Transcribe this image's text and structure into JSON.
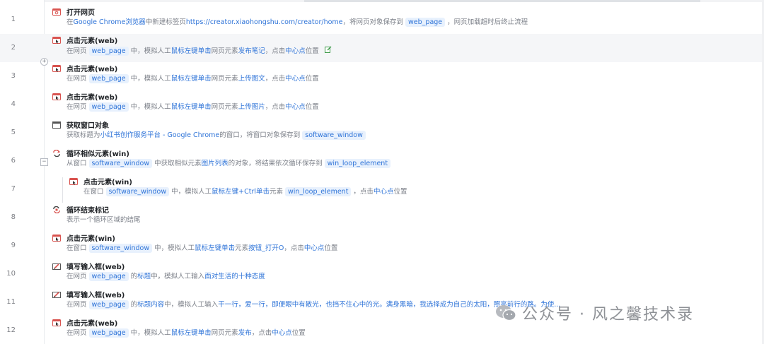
{
  "colors": {
    "accent": "#2f74d8",
    "tag_bg": "#e8f1fd",
    "title": "#202327",
    "muted": "#7c8089",
    "icon_red": "#d9534f"
  },
  "steps": [
    {
      "line": "1",
      "icon": "browser-open-icon",
      "title": "打开网页",
      "desc": [
        {
          "t": "在"
        },
        {
          "t": "Google Chrome浏览器",
          "s": "hl"
        },
        {
          "t": "中新建标签页"
        },
        {
          "t": "https://creator.xiaohongshu.com/creator/home",
          "s": "hl"
        },
        {
          "t": "，将网页对象保存到"
        },
        {
          "t": "web_page",
          "s": "tag"
        },
        {
          "t": "，网页加载超时后终止流程"
        }
      ]
    },
    {
      "line": "2",
      "icon": "click-element-icon",
      "title": "点击元素(web)",
      "desc": [
        {
          "t": "在网页"
        },
        {
          "t": "web_page",
          "s": "tag"
        },
        {
          "t": "中，模拟人工"
        },
        {
          "t": "鼠标左键单击",
          "s": "hl"
        },
        {
          "t": "网页元素"
        },
        {
          "t": "发布笔记",
          "s": "hl"
        },
        {
          "t": "，点击"
        },
        {
          "t": "中心点",
          "s": "hl"
        },
        {
          "t": "位置"
        }
      ]
    },
    {
      "line": "3",
      "icon": "click-element-icon",
      "title": "点击元素(web)",
      "desc": [
        {
          "t": "在网页"
        },
        {
          "t": "web_page",
          "s": "tag"
        },
        {
          "t": "中，模拟人工"
        },
        {
          "t": "鼠标左键单击",
          "s": "hl"
        },
        {
          "t": "网页元素"
        },
        {
          "t": "上传图文",
          "s": "hl"
        },
        {
          "t": "，点击"
        },
        {
          "t": "中心点",
          "s": "hl"
        },
        {
          "t": "位置"
        }
      ]
    },
    {
      "line": "4",
      "icon": "click-element-icon",
      "title": "点击元素(web)",
      "desc": [
        {
          "t": "在网页"
        },
        {
          "t": "web_page",
          "s": "tag"
        },
        {
          "t": "中，模拟人工"
        },
        {
          "t": "鼠标左键单击",
          "s": "hl"
        },
        {
          "t": "网页元素"
        },
        {
          "t": "上传图片",
          "s": "hl"
        },
        {
          "t": "，点击"
        },
        {
          "t": "中心点",
          "s": "hl"
        },
        {
          "t": "位置"
        }
      ]
    },
    {
      "line": "5",
      "icon": "window-icon",
      "title": "获取窗口对象",
      "desc": [
        {
          "t": "获取标题为"
        },
        {
          "t": "小红书创作服务平台 - Google Chrome",
          "s": "hl"
        },
        {
          "t": "的窗口，将窗口对象保存到"
        },
        {
          "t": "software_window",
          "s": "tag"
        }
      ]
    },
    {
      "line": "6",
      "icon": "loop-icon",
      "title": "循环相似元素(win)",
      "desc": [
        {
          "t": "从窗口"
        },
        {
          "t": "software_window",
          "s": "tag"
        },
        {
          "t": "中获取相似元素"
        },
        {
          "t": "图片列表",
          "s": "hl"
        },
        {
          "t": "的对象，将结果依次循环保存到"
        },
        {
          "t": "win_loop_element",
          "s": "tag"
        }
      ]
    },
    {
      "line": "7",
      "icon": "click-element-icon",
      "title": "点击元素(win)",
      "desc": [
        {
          "t": "在窗口"
        },
        {
          "t": "software_window",
          "s": "tag"
        },
        {
          "t": "中，模拟人工"
        },
        {
          "t": "鼠标左键+Ctrl单击",
          "s": "hl"
        },
        {
          "t": "元素"
        },
        {
          "t": "win_loop_element",
          "s": "tag"
        },
        {
          "t": "，点击"
        },
        {
          "t": "中心点",
          "s": "hl"
        },
        {
          "t": "位置"
        }
      ]
    },
    {
      "line": "8",
      "icon": "loop-end-icon",
      "title": "循环结束标记",
      "desc": [
        {
          "t": "表示一个循环区域的结尾"
        }
      ]
    },
    {
      "line": "9",
      "icon": "click-element-icon",
      "title": "点击元素(win)",
      "desc": [
        {
          "t": "在窗口"
        },
        {
          "t": "software_window",
          "s": "tag"
        },
        {
          "t": "中，模拟人工"
        },
        {
          "t": "鼠标左键单击",
          "s": "hl"
        },
        {
          "t": "元素"
        },
        {
          "t": "按钮_打开O",
          "s": "hl"
        },
        {
          "t": "，点击"
        },
        {
          "t": "中心点",
          "s": "hl"
        },
        {
          "t": "位置"
        }
      ]
    },
    {
      "line": "10",
      "icon": "fill-input-icon",
      "title": "填写输入框(web)",
      "desc": [
        {
          "t": "在网页"
        },
        {
          "t": "web_page",
          "s": "tag"
        },
        {
          "t": "的"
        },
        {
          "t": "标题",
          "s": "hl"
        },
        {
          "t": "中，模拟人工输入"
        },
        {
          "t": "面对生活的十种态度",
          "s": "hl"
        }
      ]
    },
    {
      "line": "11",
      "icon": "fill-input-icon",
      "title": "填写输入框(web)",
      "desc": [
        {
          "t": "在网页"
        },
        {
          "t": "web_page",
          "s": "tag"
        },
        {
          "t": "的"
        },
        {
          "t": "标题内容",
          "s": "hl"
        },
        {
          "t": "中，模拟人工输入"
        },
        {
          "t": "干一行，爱一行，即便眼中有散光，也挡不住心中的光。满身黑暗，我选择成为自己的太阳，照亮前行的路。为使...",
          "s": "hl"
        }
      ]
    },
    {
      "line": "12",
      "icon": "click-element-icon",
      "title": "点击元素(web)",
      "desc": [
        {
          "t": "在网页"
        },
        {
          "t": "web_page",
          "s": "tag"
        },
        {
          "t": "中，模拟人工"
        },
        {
          "t": "鼠标左键单击",
          "s": "hl"
        },
        {
          "t": "网页元素"
        },
        {
          "t": "发布",
          "s": "hl"
        },
        {
          "t": "，点击"
        },
        {
          "t": "中心点",
          "s": "hl"
        },
        {
          "t": "位置"
        }
      ]
    }
  ],
  "controls": {
    "add_symbol": "+",
    "collapse_symbol": "−",
    "edit_icon": "edit-note-icon"
  },
  "watermark": {
    "text": "公众号 · 风之馨技术录",
    "logo": "wechat-logo"
  }
}
